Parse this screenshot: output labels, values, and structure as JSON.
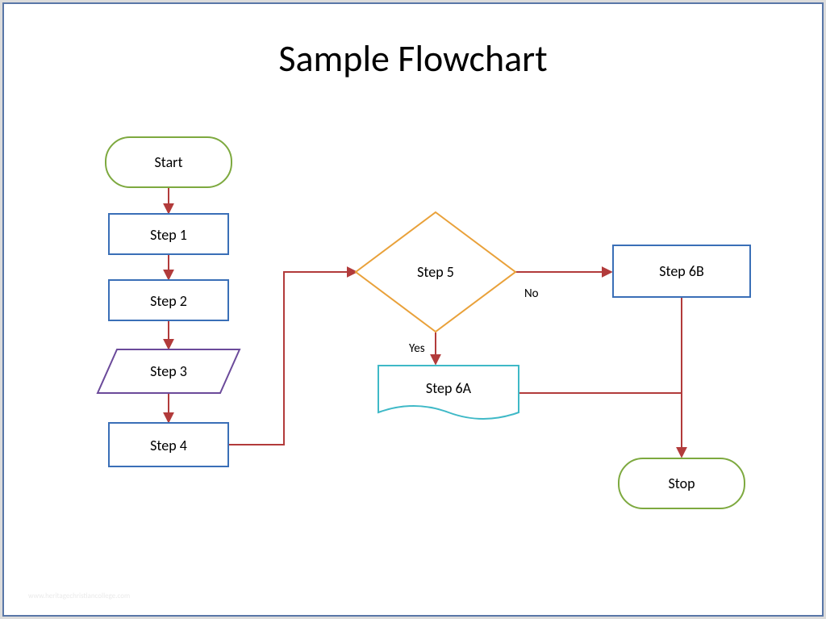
{
  "title": "Sample Flowchart",
  "nodes": {
    "start": "Start",
    "step1": "Step 1",
    "step2": "Step 2",
    "step3": "Step 3",
    "step4": "Step 4",
    "step5": "Step 5",
    "step6a": "Step 6A",
    "step6b": "Step 6B",
    "stop": "Stop"
  },
  "edges": {
    "no": "No",
    "yes": "Yes"
  },
  "colors": {
    "blue": "#3a6fb7",
    "green": "#7da93f",
    "orange": "#e9a13a",
    "purple": "#6b4a9a",
    "teal": "#3fb9c7",
    "arrow": "#b23b3b"
  },
  "footer": "www.heritagechristiancollege.com"
}
